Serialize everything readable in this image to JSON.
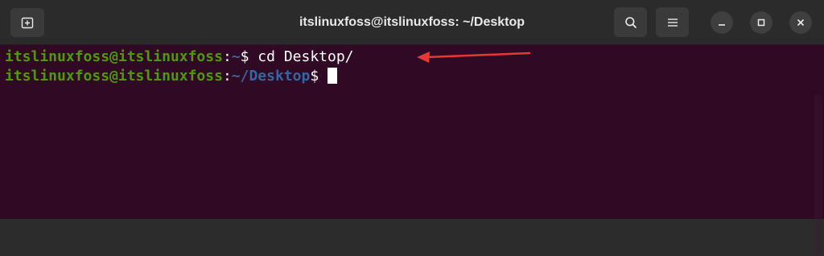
{
  "window": {
    "title": "itslinuxfoss@itslinuxfoss: ~/Desktop"
  },
  "terminal": {
    "lines": [
      {
        "user_host": "itslinuxfoss@itslinuxfoss",
        "separator": ":",
        "path": "~",
        "prompt": "$",
        "command": " cd Desktop/"
      },
      {
        "user_host": "itslinuxfoss@itslinuxfoss",
        "separator": ":",
        "path": "~/Desktop",
        "prompt": "$",
        "command": " "
      }
    ]
  },
  "icons": {
    "new_tab": "new-tab-icon",
    "search": "search-icon",
    "menu": "hamburger-menu-icon",
    "minimize": "minimize-icon",
    "maximize": "maximize-icon",
    "close": "close-icon",
    "annotation": "red-arrow-icon"
  },
  "colors": {
    "terminal_bg": "#300a24",
    "user_host": "#4e9a06",
    "path": "#3465a4",
    "arrow": "#e53935"
  }
}
